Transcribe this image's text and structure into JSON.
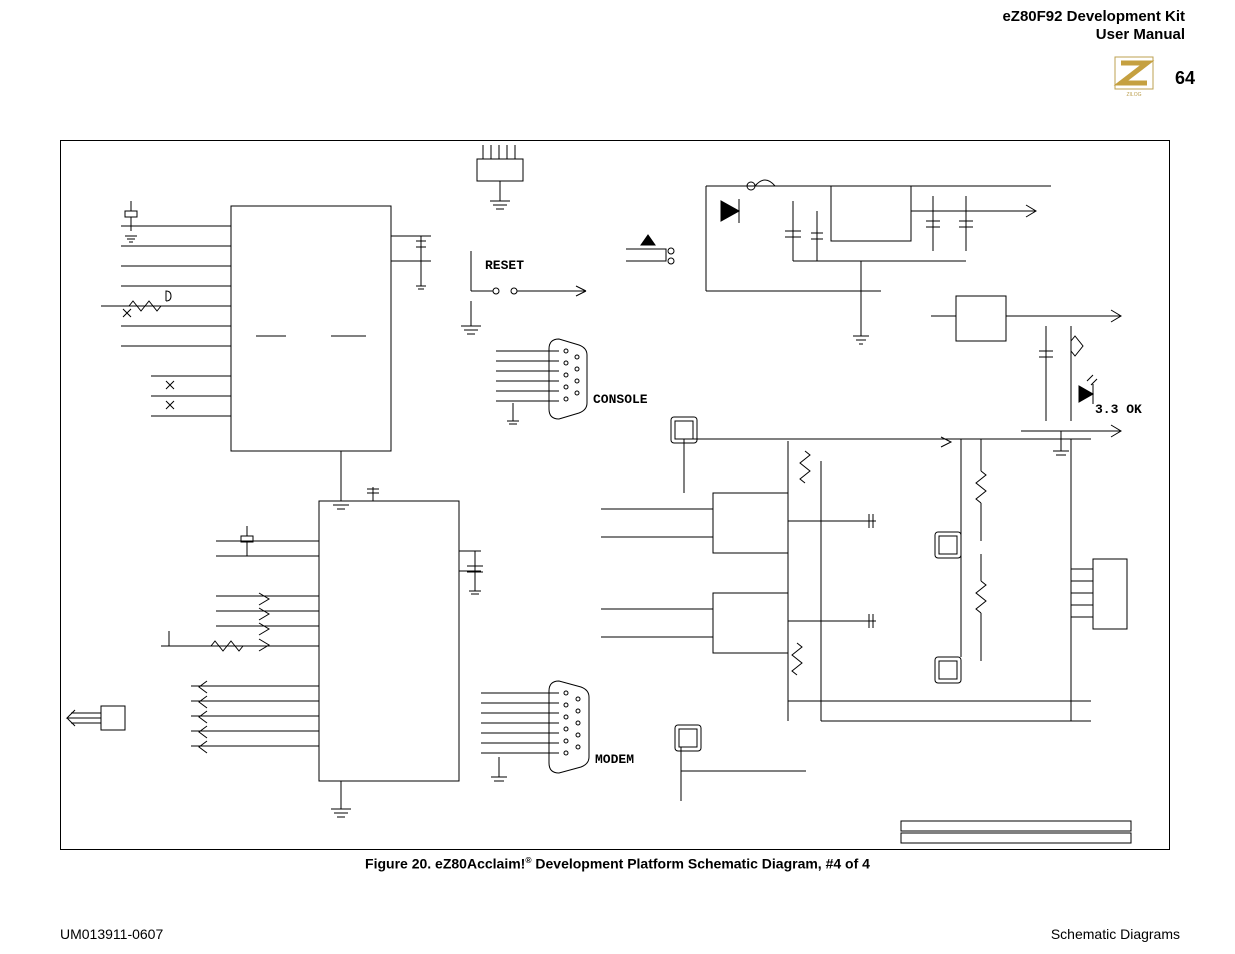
{
  "header": {
    "line1": "eZ80F92 Development Kit",
    "line2": "User Manual",
    "page_number": "64",
    "logo_text": "ZILOG"
  },
  "footer": {
    "left": "UM013911-0607",
    "right": "Schematic Diagrams"
  },
  "caption": {
    "prefix": "Figure 20. eZ80Acclaim!",
    "suffix": " Development Platform Schematic Diagram, #4 of 4"
  },
  "labels": {
    "reset": "RESET",
    "console": "CONSOLE",
    "modem": "MODEM",
    "ok33": "3.3 OK"
  }
}
